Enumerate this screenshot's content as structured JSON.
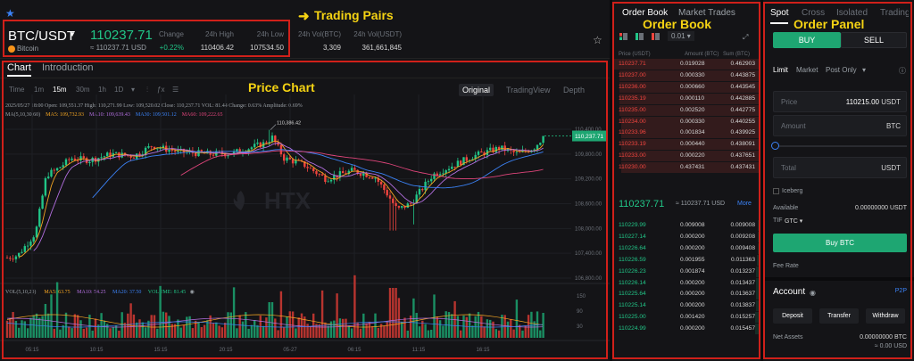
{
  "pair": {
    "symbol": "BTC/USDT",
    "coin_name": "Bitcoin",
    "last_price": "110237.71",
    "last_price_usd": "≈ 110237.71 USD",
    "stats": [
      {
        "label": "Change",
        "value": "+0.22%"
      },
      {
        "label": "24h High",
        "value": "110406.42"
      },
      {
        "label": "24h Low",
        "value": "107534.50"
      },
      {
        "label": "24h Vol(BTC)",
        "value": "3,309"
      },
      {
        "label": "24h Vol(USDT)",
        "value": "361,661,845"
      }
    ]
  },
  "annotations": {
    "trading_pairs": "Trading Pairs",
    "price_chart": "Price Chart",
    "order_book": "Order Book",
    "order_panel": "Order Panel"
  },
  "chart": {
    "tabs": [
      "Chart",
      "Introduction"
    ],
    "intervals": [
      "Time",
      "1m",
      "15m",
      "30m",
      "1h",
      "1D"
    ],
    "active_interval": "15m",
    "views": [
      "Original",
      "TradingView",
      "Depth"
    ],
    "ohlc_line": "2025/05/27 18:00   Open: 109,551.37   High: 110,271.99   Low: 109,520.02   Close: 110,237.71   VOL: 81.44   Change: 0.63%   Amplitude: 0.69%",
    "ma_label": "MA(5,10,30,60)",
    "ma": [
      {
        "label": "MA5: 109,732.93",
        "color": "#f5a623"
      },
      {
        "label": "MA10: 109,639.43",
        "color": "#b36fe0"
      },
      {
        "label": "MA30: 109,501.12",
        "color": "#3b82f6"
      },
      {
        "label": "MA60: 109,222.65",
        "color": "#e0457b"
      }
    ],
    "vol_label": "VOL(5,10,20)",
    "vol_ma": [
      {
        "label": "MA5: 63.75",
        "color": "#f5a623"
      },
      {
        "label": "MA10: 54.25",
        "color": "#b36fe0"
      },
      {
        "label": "MA20: 37.50",
        "color": "#3b82f6"
      },
      {
        "label": "VOLUME: 81.45",
        "color": "#21c587"
      }
    ],
    "high_marker": "110,386.42",
    "price_tag": "110,237.71",
    "y_ticks": [
      "110,400.00",
      "109,800.00",
      "109,200.00",
      "108,600.00",
      "108,000.00",
      "107,400.00",
      "106,800.00"
    ],
    "vol_ticks": [
      "150",
      "90",
      "30"
    ],
    "x_ticks": [
      "05:15",
      "10:15",
      "15:15",
      "20:15",
      "05-27",
      "06:15",
      "11:15",
      "16:15"
    ],
    "watermark": "HTX"
  },
  "order_book": {
    "tabs": [
      "Order Book",
      "Market Trades"
    ],
    "precision": "0.01",
    "headers": [
      "Price (USDT)",
      "Amount (BTC)",
      "Sum (BTC)"
    ],
    "asks": [
      {
        "price": "110237.71",
        "amount": "0.019028",
        "sum": "0.462903",
        "depth": 0.99
      },
      {
        "price": "110237.00",
        "amount": "0.000330",
        "sum": "0.443875",
        "depth": 0.95
      },
      {
        "price": "110236.00",
        "amount": "0.000660",
        "sum": "0.443545",
        "depth": 0.95
      },
      {
        "price": "110235.19",
        "amount": "0.000110",
        "sum": "0.442885",
        "depth": 0.95
      },
      {
        "price": "110235.00",
        "amount": "0.002520",
        "sum": "0.442775",
        "depth": 0.95
      },
      {
        "price": "110234.00",
        "amount": "0.000330",
        "sum": "0.440255",
        "depth": 0.94
      },
      {
        "price": "110233.96",
        "amount": "0.001834",
        "sum": "0.439925",
        "depth": 0.94
      },
      {
        "price": "110233.19",
        "amount": "0.000440",
        "sum": "0.438091",
        "depth": 0.94
      },
      {
        "price": "110233.00",
        "amount": "0.000220",
        "sum": "0.437651",
        "depth": 0.94
      },
      {
        "price": "110230.00",
        "amount": "0.437431",
        "sum": "0.437431",
        "depth": 0.94
      }
    ],
    "mid_price": "110237.71",
    "mid_usd": "≈ 110237.71 USD",
    "more": "More",
    "bids": [
      {
        "price": "110229.99",
        "amount": "0.009008",
        "sum": "0.009008",
        "depth": 0.02
      },
      {
        "price": "110227.14",
        "amount": "0.000200",
        "sum": "0.009208",
        "depth": 0.02
      },
      {
        "price": "110226.64",
        "amount": "0.000200",
        "sum": "0.009408",
        "depth": 0.02
      },
      {
        "price": "110226.59",
        "amount": "0.001955",
        "sum": "0.011363",
        "depth": 0.025
      },
      {
        "price": "110226.23",
        "amount": "0.001874",
        "sum": "0.013237",
        "depth": 0.03
      },
      {
        "price": "110226.14",
        "amount": "0.000200",
        "sum": "0.013437",
        "depth": 0.03
      },
      {
        "price": "110225.64",
        "amount": "0.000200",
        "sum": "0.013637",
        "depth": 0.03
      },
      {
        "price": "110225.14",
        "amount": "0.000200",
        "sum": "0.013837",
        "depth": 0.03
      },
      {
        "price": "110225.00",
        "amount": "0.001420",
        "sum": "0.015257",
        "depth": 0.035
      },
      {
        "price": "110224.99",
        "amount": "0.000200",
        "sum": "0.015457",
        "depth": 0.035
      }
    ]
  },
  "order_panel": {
    "tabs": [
      "Spot",
      "Cross",
      "Isolated",
      "Trading"
    ],
    "buy": "BUY",
    "sell": "SELL",
    "order_types": [
      "Limit",
      "Market",
      "Post Only"
    ],
    "price_label": "Price",
    "price_value": "110215.00",
    "price_unit": "USDT",
    "amount_label": "Amount",
    "amount_unit": "BTC",
    "total_label": "Total",
    "total_unit": "USDT",
    "iceberg": "Iceberg",
    "available_label": "Available",
    "available_value": "0.00000000 USDT",
    "tif_label": "TIF",
    "tif_value": "GTC",
    "buy_btc": "Buy BTC",
    "fee_rate": "Fee Rate",
    "account_title": "Account",
    "p2p": "P2P",
    "account_buttons": [
      "Deposit",
      "Transfer",
      "Withdraw"
    ],
    "net_assets_label": "Net Assets",
    "net_assets_value": "0.00000000 BTC",
    "net_assets_usd": "≈ 0.00 USD"
  }
}
